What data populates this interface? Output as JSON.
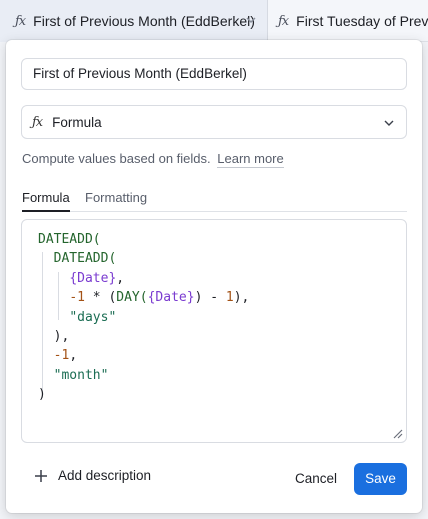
{
  "columns": {
    "active": {
      "icon": "formula-icon",
      "label": "First of Previous Month (EddBerkel)"
    },
    "next": {
      "icon": "formula-icon",
      "label": "First Tuesday of Previou"
    }
  },
  "field_name": {
    "value": "First of Previous Month (EddBerkel)"
  },
  "field_type": {
    "icon": "formula-icon",
    "label": "Formula"
  },
  "help": {
    "text": "Compute values based on fields.",
    "link": "Learn more"
  },
  "tabs": [
    {
      "label": "Formula",
      "selected": true
    },
    {
      "label": "Formatting",
      "selected": false
    }
  ],
  "formula": {
    "line1": "DATEADD(",
    "line2": "DATEADD(",
    "line3_field": "{Date}",
    "line3_punct": ",",
    "line4_num1": "-1",
    "line4_op": " * (",
    "line4_fn": "DAY(",
    "line4_field": "{Date}",
    "line4_close": ") - ",
    "line4_num2": "1",
    "line4_end": "),",
    "line5_str": "\"days\"",
    "line6": "),",
    "line7_num": "-1",
    "line7_punct": ",",
    "line8_str": "\"month\"",
    "line9": ")"
  },
  "footer": {
    "add_description": "Add description",
    "cancel": "Cancel",
    "save": "Save"
  },
  "colors": {
    "accent": "#1a6fdf",
    "field_token": "#7a3bd0",
    "function_token": "#24652d"
  }
}
